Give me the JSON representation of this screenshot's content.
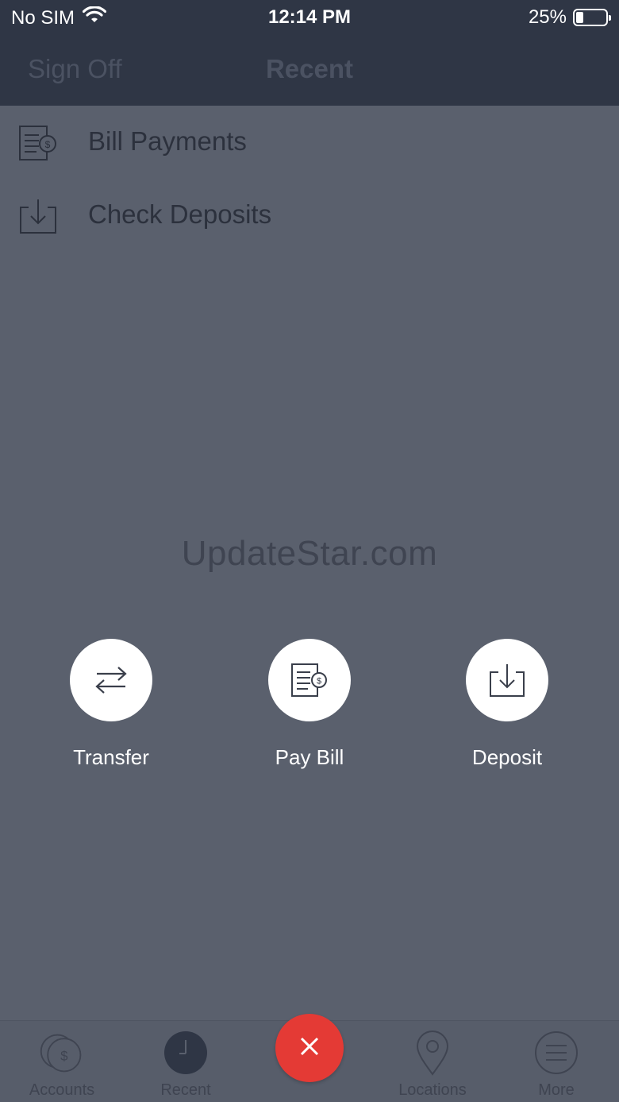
{
  "status_bar": {
    "carrier": "No SIM",
    "time": "12:14 PM",
    "battery_percent": "25%",
    "battery_level": 0.25,
    "wifi_icon": "wifi-icon"
  },
  "header": {
    "left_action": "Sign Off",
    "title": "Recent"
  },
  "recent_items": [
    {
      "label": "Bill Payments",
      "icon": "bill-icon"
    },
    {
      "label": "Check Deposits",
      "icon": "deposit-icon"
    }
  ],
  "watermark": "UpdateStar.com",
  "actions": [
    {
      "label": "Transfer",
      "icon": "transfer-icon"
    },
    {
      "label": "Pay Bill",
      "icon": "bill-icon"
    },
    {
      "label": "Deposit",
      "icon": "deposit-icon"
    }
  ],
  "tab_bar": {
    "tabs": [
      {
        "label": "Accounts",
        "icon": "accounts-icon"
      },
      {
        "label": "Recent",
        "icon": "clock-icon"
      },
      {
        "label": "Locations",
        "icon": "location-pin-icon"
      },
      {
        "label": "More",
        "icon": "menu-icon"
      }
    ],
    "close_button_icon": "close-icon"
  },
  "colors": {
    "overlay": "#5a606d",
    "header": "#2f3645",
    "accent_red": "#e43a35",
    "white": "#ffffff"
  }
}
